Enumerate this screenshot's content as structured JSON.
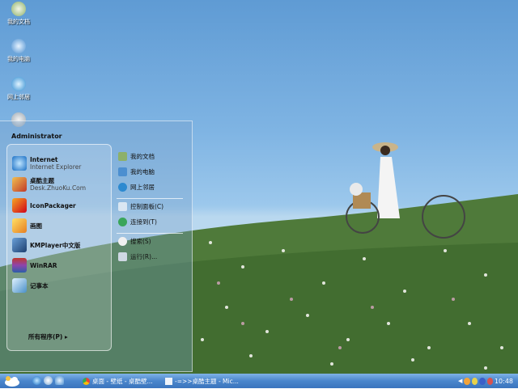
{
  "desktop": {
    "icons": [
      {
        "label": "我的文档"
      },
      {
        "label": "我的电脑"
      },
      {
        "label": "网上邻居"
      }
    ]
  },
  "start_menu": {
    "user": "Administrator",
    "pinned": [
      {
        "title": "Internet",
        "subtitle": "Internet Explorer"
      },
      {
        "title": "桌酷主题",
        "subtitle": "Desk.ZhuoKu.Com"
      }
    ],
    "programs": [
      {
        "title": "IconPackager"
      },
      {
        "title": "画图"
      },
      {
        "title": "KMPlayer中文版"
      },
      {
        "title": "WinRAR"
      },
      {
        "title": "记事本"
      }
    ],
    "all_programs": "所有程序(P)",
    "right": {
      "my_docs": "我的文档",
      "my_computer": "我的电脑",
      "network": "网上邻居",
      "control_panel": "控制面板(C)",
      "connect": "连接到(T)",
      "search": "搜索(S)",
      "run": "运行(R)..."
    }
  },
  "taskbar": {
    "buttons": [
      {
        "label": "桌面 - 壁纸 - 桌酷壁..."
      },
      {
        "label": "-=>>桌酷主题 - Mic..."
      }
    ],
    "clock": "10:48"
  }
}
